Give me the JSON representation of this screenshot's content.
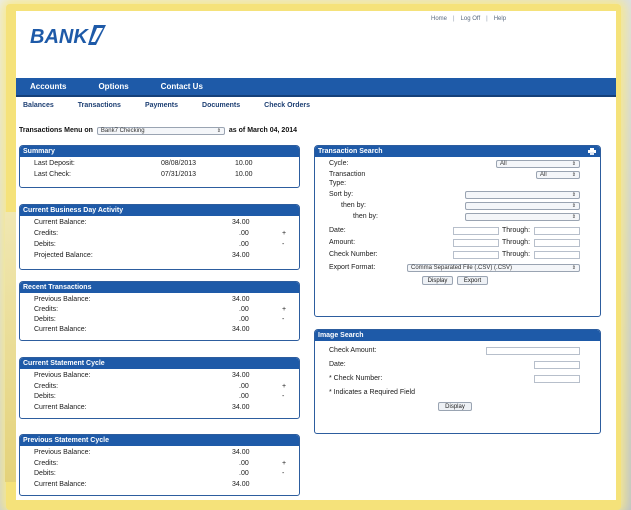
{
  "header": {
    "logo_text": "BANK",
    "links": [
      "Home",
      "Log Off",
      "Help"
    ]
  },
  "nav": {
    "items": [
      "Accounts",
      "Options",
      "Contact Us"
    ]
  },
  "subnav": {
    "items": [
      "Balances",
      "Transactions",
      "Payments",
      "Documents",
      "Check Orders"
    ]
  },
  "menu": {
    "label": "Transactions Menu on",
    "account": "Bank7 Checking",
    "as_of": "as of March 04, 2014"
  },
  "summary": {
    "title": "Summary",
    "rows": [
      {
        "label": "Last Deposit:",
        "date": "08/08/2013",
        "amount": "10.00"
      },
      {
        "label": "Last Check:",
        "date": "07/31/2013",
        "amount": "10.00"
      }
    ]
  },
  "current_business": {
    "title": "Current Business Day Activity",
    "rows": [
      {
        "label": "Current Balance:",
        "amount": "34.00",
        "sign": ""
      },
      {
        "label": "Credits:",
        "amount": ".00",
        "sign": "+"
      },
      {
        "label": "Debits:",
        "amount": ".00",
        "sign": "-"
      },
      {
        "label": "Projected Balance:",
        "amount": "34.00",
        "sign": ""
      }
    ]
  },
  "recent": {
    "title": "Recent Transactions",
    "rows": [
      {
        "label": "Previous Balance:",
        "amount": "34.00",
        "sign": ""
      },
      {
        "label": "Credits:",
        "amount": ".00",
        "sign": "+"
      },
      {
        "label": "Debits:",
        "amount": ".00",
        "sign": "-"
      },
      {
        "label": "Current Balance:",
        "amount": "34.00",
        "sign": ""
      }
    ]
  },
  "current_statement": {
    "title": "Current Statement Cycle",
    "rows": [
      {
        "label": "Previous Balance:",
        "amount": "34.00",
        "sign": ""
      },
      {
        "label": "Credits:",
        "amount": ".00",
        "sign": "+"
      },
      {
        "label": "Debits:",
        "amount": ".00",
        "sign": "-"
      },
      {
        "label": "Current Balance:",
        "amount": "34.00",
        "sign": ""
      }
    ]
  },
  "previous_statement": {
    "title": "Previous Statement Cycle",
    "rows": [
      {
        "label": "Previous Balance:",
        "amount": "34.00",
        "sign": ""
      },
      {
        "label": "Credits:",
        "amount": ".00",
        "sign": "+"
      },
      {
        "label": "Debits:",
        "amount": ".00",
        "sign": "-"
      },
      {
        "label": "Current Balance:",
        "amount": "34.00",
        "sign": ""
      }
    ]
  },
  "txn_search": {
    "title": "Transaction Search",
    "cycle_label": "Cycle:",
    "cycle_value": "All",
    "type_label_1": "Transaction",
    "type_label_2": "Type:",
    "type_value": "All",
    "sort_by": "Sort by:",
    "then_by_1": "then by:",
    "then_by_2": "then by:",
    "date": "Date:",
    "amount": "Amount:",
    "check_number": "Check Number:",
    "through": "Through:",
    "export_label": "Export Format:",
    "export_value": "Comma Separated File (.CSV) (.CSV)",
    "display_btn": "Display",
    "export_btn": "Export"
  },
  "image_search": {
    "title": "Image Search",
    "check_amount": "Check Amount:",
    "date": "Date:",
    "check_number": "* Check Number:",
    "required_note": "* Indicates a Required Field",
    "display_btn": "Display"
  }
}
